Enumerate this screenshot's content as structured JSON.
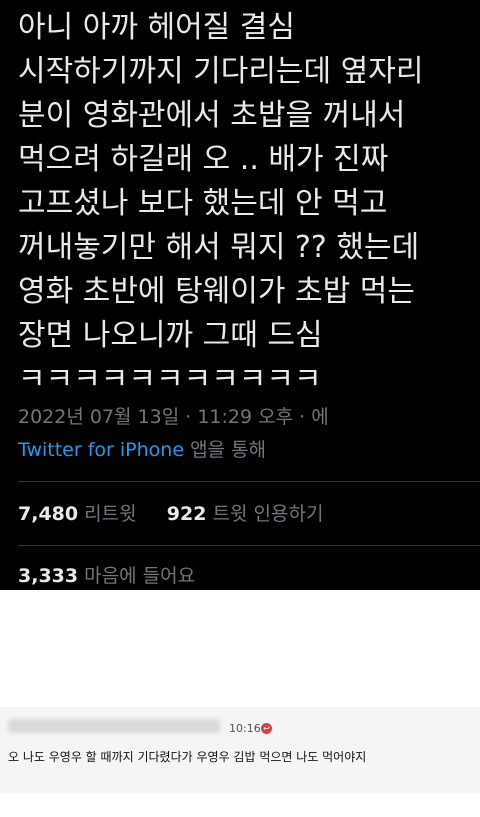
{
  "tweet": {
    "text_lines": [
      "아니 아까 헤어질 결심",
      "시작하기까지 기다리는데 옆자리",
      "분이 영화관에서 초밥을 꺼내서",
      "먹으려 하길래 오 .. 배가 진짜",
      "고프셨나 보다 했는데 안 먹고",
      "꺼내놓기만 해서 뭐지 ?? 했는데",
      "영화 초반에 탕웨이가 초밥 먹는",
      "장면 나오니까 그때 드심",
      "ㅋㅋㅋㅋㅋㅋㅋㅋㅋㅋㅋ"
    ],
    "timestamp": "2022년 07월 13일 · 11:29 오후 · 에",
    "source_app": "Twitter for iPhone",
    "source_suffix": " 앱을 통해",
    "retweets_count": "7,480",
    "retweets_label": " 리트윗",
    "quotes_count": "922",
    "quotes_label": " 트윗 인용하기",
    "likes_count": "3,333",
    "likes_label": " 마음에 들어요"
  },
  "comment": {
    "time": "10:16",
    "text": "오 나도 우영우 할 때까지 기다렸다가 우영우 김밥 먹으면 나도 먹어야지"
  },
  "colors": {
    "tweet_bg": "#000000",
    "tweet_text": "#e7e9ea",
    "meta_text": "#71767b",
    "link": "#1d9bf0",
    "comment_bg": "#f5f5f5"
  }
}
